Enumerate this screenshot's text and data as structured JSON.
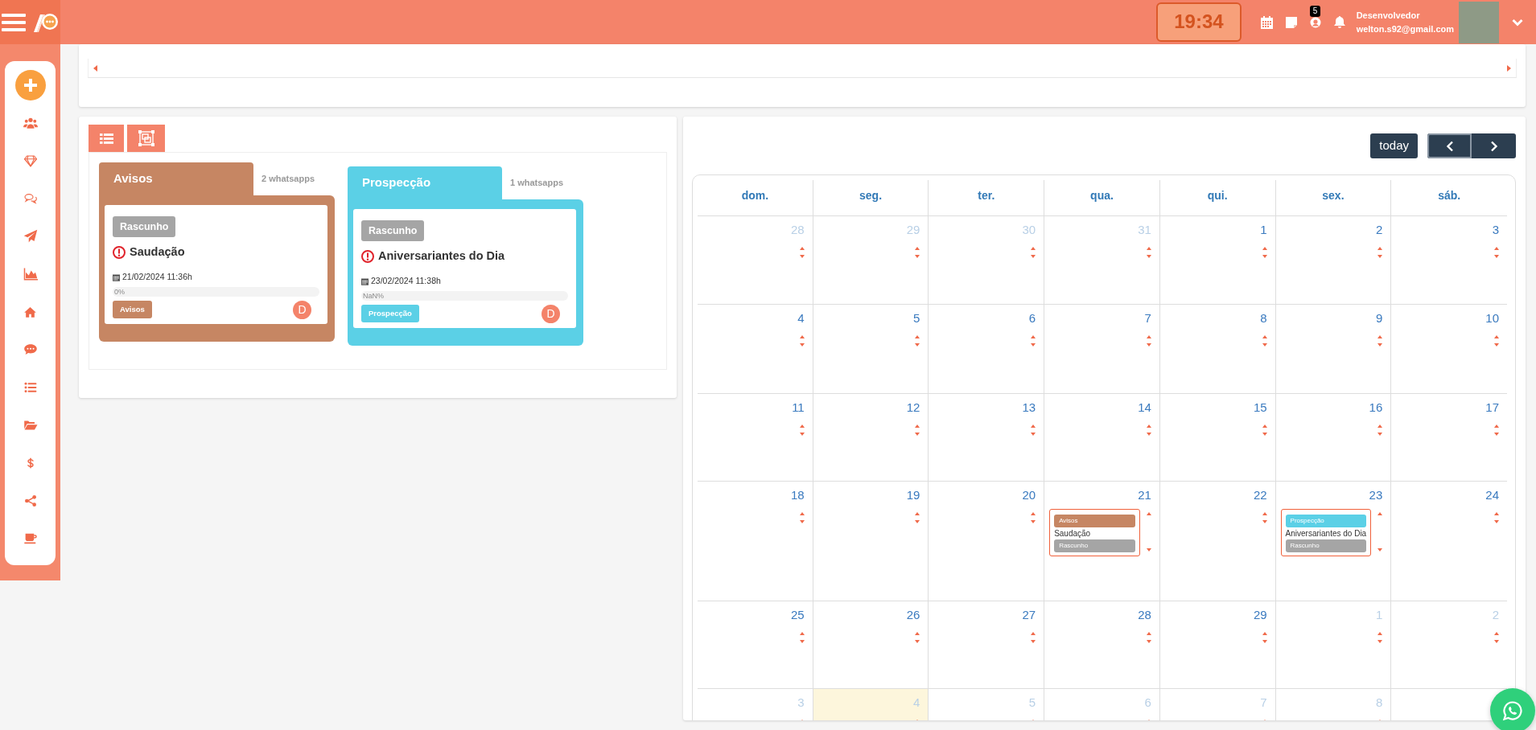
{
  "topbar": {
    "clock": "19:34",
    "notification_count": "5",
    "user": {
      "role": "Desenvolvedor",
      "email": "welton.s92@gmail.com"
    }
  },
  "board": {
    "columns": [
      {
        "title": "Avisos",
        "count": "2 whatsapps",
        "color": "#c68663",
        "cards": [
          {
            "status": "Rascunho",
            "title": "Saudação",
            "date": "21/02/2024 11:36h",
            "progress_label": "0%",
            "level": 0,
            "tag": "Avisos",
            "avatar": "D"
          }
        ]
      },
      {
        "title": "Prospecção",
        "count": "1 whatsapps",
        "color": "#5bd0e6",
        "cards": [
          {
            "status": "Rascunho",
            "title": "Aniversariantes do Dia",
            "date": "23/02/2024 11:38h",
            "progress_label": "NaN%",
            "level": 0,
            "tag": "Prospecção",
            "avatar": "D"
          }
        ]
      }
    ]
  },
  "calendar": {
    "today_button": "today",
    "weekdays": [
      "dom.",
      "seg.",
      "ter.",
      "qua.",
      "qui.",
      "sex.",
      "sáb."
    ],
    "weeks": [
      [
        {
          "day": "28",
          "muted": true,
          "today": false
        },
        {
          "day": "29",
          "muted": true,
          "today": false
        },
        {
          "day": "30",
          "muted": true,
          "today": false
        },
        {
          "day": "31",
          "muted": true,
          "today": false
        },
        {
          "day": "1",
          "muted": false,
          "today": false
        },
        {
          "day": "2",
          "muted": false,
          "today": false
        },
        {
          "day": "3",
          "muted": false,
          "today": false
        }
      ],
      [
        {
          "day": "4",
          "muted": false,
          "today": false
        },
        {
          "day": "5",
          "muted": false,
          "today": false
        },
        {
          "day": "6",
          "muted": false,
          "today": false
        },
        {
          "day": "7",
          "muted": false,
          "today": false
        },
        {
          "day": "8",
          "muted": false,
          "today": false
        },
        {
          "day": "9",
          "muted": false,
          "today": false
        },
        {
          "day": "10",
          "muted": false,
          "today": false
        }
      ],
      [
        {
          "day": "11",
          "muted": false,
          "today": false
        },
        {
          "day": "12",
          "muted": false,
          "today": false
        },
        {
          "day": "13",
          "muted": false,
          "today": false
        },
        {
          "day": "14",
          "muted": false,
          "today": false
        },
        {
          "day": "15",
          "muted": false,
          "today": false
        },
        {
          "day": "16",
          "muted": false,
          "today": false
        },
        {
          "day": "17",
          "muted": false,
          "today": false
        }
      ],
      [
        {
          "day": "18",
          "muted": false,
          "today": false
        },
        {
          "day": "19",
          "muted": false,
          "today": false
        },
        {
          "day": "20",
          "muted": false,
          "today": false
        },
        {
          "day": "21",
          "muted": false,
          "today": false,
          "events": [
            {
              "tag": "Avisos",
              "color": "#c68663",
              "title": "Saudação",
              "status": "Rascunho"
            }
          ]
        },
        {
          "day": "22",
          "muted": false,
          "today": false
        },
        {
          "day": "23",
          "muted": false,
          "today": false,
          "events": [
            {
              "tag": "Prospecção",
              "color": "#5bd0e6",
              "title": "Aniversariantes do Dia",
              "status": "Rascunho"
            }
          ]
        },
        {
          "day": "24",
          "muted": false,
          "today": false
        }
      ],
      [
        {
          "day": "25",
          "muted": false,
          "today": false
        },
        {
          "day": "26",
          "muted": false,
          "today": false
        },
        {
          "day": "27",
          "muted": false,
          "today": false
        },
        {
          "day": "28",
          "muted": false,
          "today": false
        },
        {
          "day": "29",
          "muted": false,
          "today": false
        },
        {
          "day": "1",
          "muted": true,
          "today": false
        },
        {
          "day": "2",
          "muted": true,
          "today": false
        }
      ],
      [
        {
          "day": "3",
          "muted": true,
          "today": false
        },
        {
          "day": "4",
          "muted": true,
          "today": true
        },
        {
          "day": "5",
          "muted": true,
          "today": false
        },
        {
          "day": "6",
          "muted": true,
          "today": false
        },
        {
          "day": "7",
          "muted": true,
          "today": false
        },
        {
          "day": "8",
          "muted": true,
          "today": false
        },
        {
          "today": false
        }
      ]
    ]
  }
}
